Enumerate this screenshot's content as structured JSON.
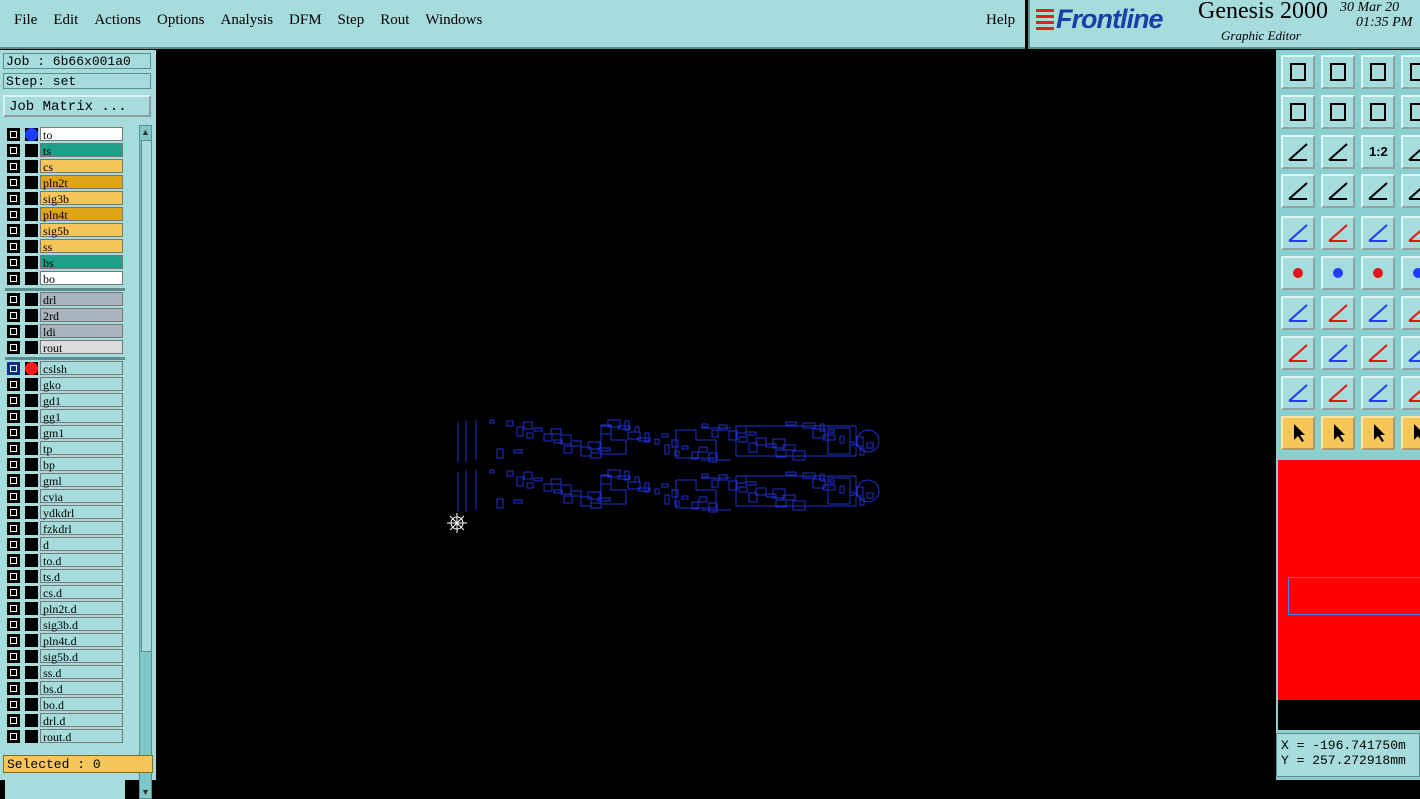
{
  "menu": {
    "items": [
      "File",
      "Edit",
      "Actions",
      "Options",
      "Analysis",
      "DFM",
      "Step",
      "Rout",
      "Windows"
    ],
    "help": "Help"
  },
  "brand": {
    "logo": "Frontline",
    "product": "Genesis 2000",
    "subtitle": "Graphic Editor",
    "date": "30 Mar 20",
    "time": "01:35 PM"
  },
  "left": {
    "job": "Job : 6b66x001a0",
    "step": "Step: set",
    "job_matrix": "Job Matrix ...",
    "selected": "Selected : 0",
    "layers_board": [
      {
        "name": "to",
        "color": "#ffffff",
        "dot": "#1f3cff"
      },
      {
        "name": "ts",
        "color": "#1f9f87",
        "dot": ""
      },
      {
        "name": "cs",
        "color": "#f6c65a",
        "dot": ""
      },
      {
        "name": "pln2t",
        "color": "#e0a419",
        "dot": ""
      },
      {
        "name": "sig3b",
        "color": "#f6c65a",
        "dot": ""
      },
      {
        "name": "pln4t",
        "color": "#e0a419",
        "dot": ""
      },
      {
        "name": "sig5b",
        "color": "#f6c65a",
        "dot": ""
      },
      {
        "name": "ss",
        "color": "#f6c65a",
        "dot": ""
      },
      {
        "name": "bs",
        "color": "#1f9f87",
        "dot": ""
      },
      {
        "name": "bo",
        "color": "#ffffff",
        "dot": ""
      }
    ],
    "layers_drill": [
      {
        "name": "drl",
        "color": "#a8b4be"
      },
      {
        "name": "2rd",
        "color": "#a8b4be"
      },
      {
        "name": "ldi",
        "color": "#a8b4be"
      },
      {
        "name": "rout",
        "color": "#dcdcdc"
      }
    ],
    "layers_misc": [
      {
        "name": "cslsh",
        "dot": "#ff1a1a",
        "selected": true
      },
      {
        "name": "gko"
      },
      {
        "name": "gd1"
      },
      {
        "name": "gg1"
      },
      {
        "name": "gm1"
      },
      {
        "name": "tp"
      },
      {
        "name": "bp"
      },
      {
        "name": "gml"
      },
      {
        "name": "cvia"
      },
      {
        "name": "ydkdrl"
      },
      {
        "name": "fzkdrl"
      },
      {
        "name": "d"
      },
      {
        "name": "to.d"
      },
      {
        "name": "ts.d"
      },
      {
        "name": "cs.d"
      },
      {
        "name": "pln2t.d"
      },
      {
        "name": "sig3b.d"
      },
      {
        "name": "pln4t.d"
      },
      {
        "name": "sig5b.d"
      },
      {
        "name": "ss.d"
      },
      {
        "name": "bs.d"
      },
      {
        "name": "bo.d"
      },
      {
        "name": "drl.d"
      },
      {
        "name": "rout.d"
      }
    ],
    "misc_color": "#a6dcdc"
  },
  "canvas": {
    "background": "#000000",
    "feature_color": "#2030d0"
  },
  "coords": {
    "x": "X = -196.741750m",
    "y": "Y = 257.272918mm"
  },
  "toolbar_icons": [
    [
      "export-icon",
      "import-icon",
      "home-icon",
      "frame-icon"
    ],
    [
      "move-left-icon",
      "move-right-icon",
      "undo-move-icon",
      "swap-icon"
    ],
    [
      "fit-icon",
      "zoom-center-icon",
      "ratio-icon",
      "help-icon"
    ],
    [
      "wrench-icon",
      "probe-icon",
      "net-icon",
      "net2-icon"
    ],
    [
      "fill-icon",
      "draw-icon",
      "ruler-icon",
      "circle-icon"
    ],
    [
      "connect-icon",
      "cross-icon",
      "point-icon",
      "point2-icon"
    ],
    [
      "angle-icon",
      "line-icon",
      "arc-icon",
      "bracket-icon"
    ],
    [
      "pad-icon",
      "dash-icon",
      "measure-icon",
      "search2-icon"
    ],
    [
      "triangle-icon",
      "a-icon",
      "arrow-a-icon",
      "arrow-a2-icon"
    ],
    [
      "cursor-icon",
      "cursor-box-icon",
      "cursor-circle-icon",
      "cursor-step-icon"
    ]
  ],
  "toolbar_button_label": "1:2"
}
